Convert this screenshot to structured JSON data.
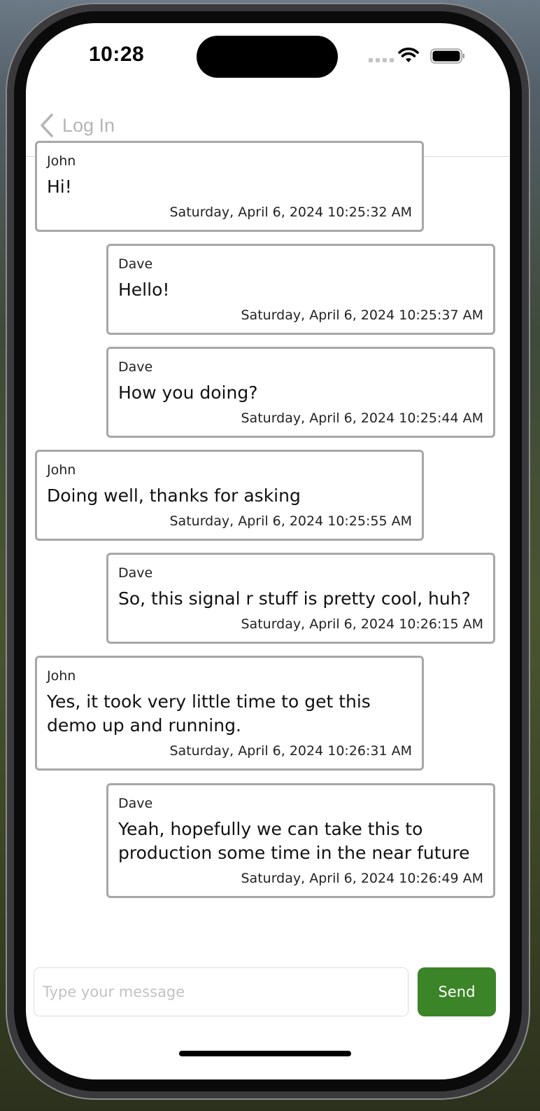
{
  "status_bar": {
    "time": "10:28"
  },
  "nav": {
    "back_label": "Log In"
  },
  "messages": [
    {
      "sender": "John",
      "text": "Hi!",
      "timestamp": "Saturday, April 6, 2024 10:25:32 AM",
      "align": "left"
    },
    {
      "sender": "Dave",
      "text": "Hello!",
      "timestamp": "Saturday, April 6, 2024 10:25:37 AM",
      "align": "right"
    },
    {
      "sender": "Dave",
      "text": "How you doing?",
      "timestamp": "Saturday, April 6, 2024 10:25:44 AM",
      "align": "right"
    },
    {
      "sender": "John",
      "text": "Doing well, thanks for asking",
      "timestamp": "Saturday, April 6, 2024 10:25:55 AM",
      "align": "left"
    },
    {
      "sender": "Dave",
      "text": "So, this signal r stuff is pretty cool, huh?",
      "timestamp": "Saturday, April 6, 2024 10:26:15 AM",
      "align": "right"
    },
    {
      "sender": "John",
      "text": "Yes, it took very little time to get this demo up and running.",
      "timestamp": "Saturday, April 6, 2024 10:26:31 AM",
      "align": "left"
    },
    {
      "sender": "Dave",
      "text": "Yeah, hopefully we can take this to production some time in the near future",
      "timestamp": "Saturday, April 6, 2024 10:26:49 AM",
      "align": "right"
    }
  ],
  "composer": {
    "placeholder": "Type your message",
    "value": "",
    "send_label": "Send"
  },
  "colors": {
    "send_button": "#3b8427",
    "bubble_border": "#a7a7a7",
    "back_text": "#b5b5b5"
  }
}
